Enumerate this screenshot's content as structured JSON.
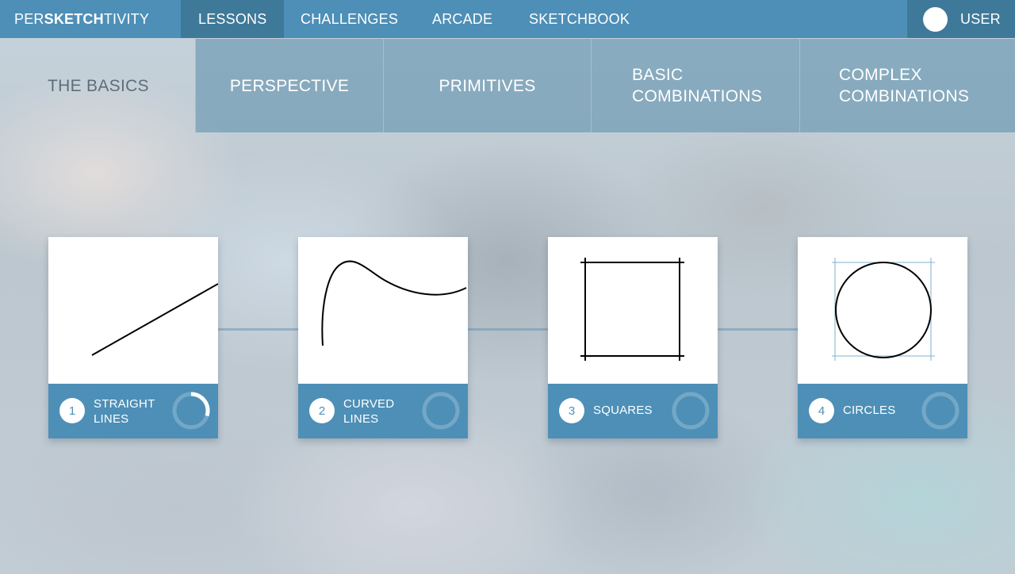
{
  "brand": {
    "part1": "PER",
    "part2": "SKETCH",
    "part3": "TIVITY"
  },
  "nav": {
    "items": [
      {
        "label": "LESSONS"
      },
      {
        "label": "CHALLENGES"
      },
      {
        "label": "ARCADE"
      },
      {
        "label": "SKETCHBOOK"
      }
    ],
    "active": "LESSONS"
  },
  "user": {
    "label": "USER"
  },
  "subtabs": [
    {
      "label": "THE BASICS"
    },
    {
      "label": "PERSPECTIVE"
    },
    {
      "label": "PRIMITIVES"
    },
    {
      "label": "BASIC COMBINATIONS"
    },
    {
      "label": "COMPLEX COMBINATIONS"
    }
  ],
  "subtabs_active": "THE BASICS",
  "lessons": [
    {
      "number": "1",
      "title": "STRAIGHT LINES",
      "progress": 0.3,
      "icon": "straight-line-icon"
    },
    {
      "number": "2",
      "title": "CURVED LINES",
      "progress": 0,
      "icon": "curved-line-icon"
    },
    {
      "number": "3",
      "title": "SQUARES",
      "progress": 0,
      "icon": "square-icon"
    },
    {
      "number": "4",
      "title": "CIRCLES",
      "progress": 0,
      "icon": "circle-icon"
    }
  ],
  "colors": {
    "primary": "#4d8fb7",
    "active_nav": "#3f7999",
    "guide_line": "#7fb2cf"
  }
}
